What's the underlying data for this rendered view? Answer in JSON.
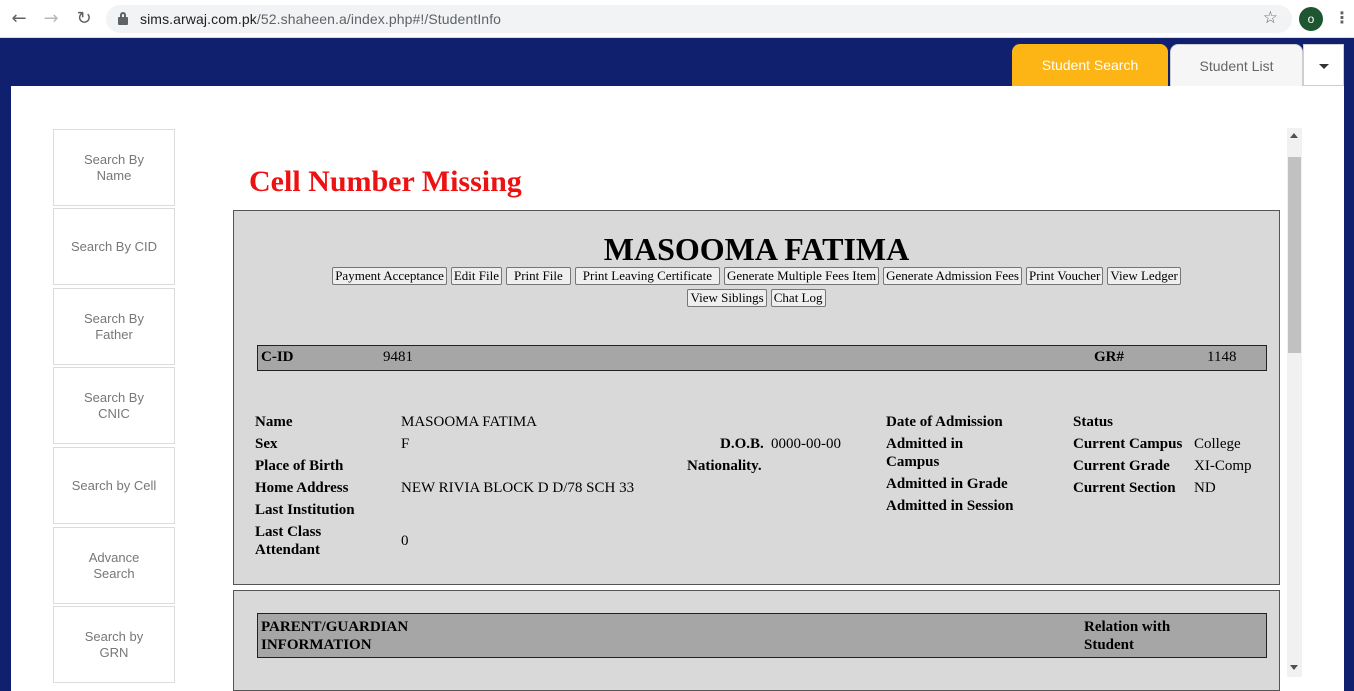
{
  "browser": {
    "url_host": "sims.arwaj.com.pk",
    "url_path": "/52.shaheen.a/index.php#!/StudentInfo",
    "profile_initial": "o"
  },
  "tabs": {
    "search": "Student Search",
    "list": "Student List"
  },
  "menu": [
    "Search By Name",
    "Search By CID",
    "Search By Father",
    "Search By CNIC",
    "Search by Cell",
    "Advance Search",
    "Search by GRN"
  ],
  "alert": "Cell Number Missing",
  "student": {
    "name": "MASOOMA FATIMA",
    "actions": [
      "Payment Acceptance",
      "Edit File",
      "Print File",
      "Print Leaving Certificate",
      "Generate Multiple Fees Item",
      "Generate Admission Fees",
      "Print Voucher",
      "View Ledger",
      "View Siblings",
      "Chat Log"
    ],
    "cid_label": "C-ID",
    "cid": "9481",
    "gr_label": "GR#",
    "gr": "1148",
    "fields": {
      "name_label": "Name",
      "name": "MASOOMA FATIMA",
      "sex_label": "Sex",
      "sex": "F",
      "dob_label": "D.O.B.",
      "dob": "0000-00-00",
      "pob_label": "Place of Birth",
      "nationality_label": "Nationality.",
      "address_label": "Home Address",
      "address": "NEW RIVIA BLOCK D D/78 SCH 33",
      "last_inst_label": "Last Institution",
      "last_class_label": "Last Class Attendant",
      "last_class": "0",
      "doa_label": "Date of Admission",
      "adm_campus_label": "Admitted in Campus",
      "adm_grade_label": "Admitted in Grade",
      "adm_session_label": "Admitted in Session",
      "status_label": "Status",
      "campus_label": "Current Campus",
      "campus": "College",
      "grade_label": "Current Grade",
      "grade": "XI-Comp",
      "section_label": "Current Section",
      "section": "ND"
    }
  },
  "parent": {
    "header": "PARENT/GUARDIAN INFORMATION",
    "relation": "Relation with Student"
  },
  "colors": {
    "header_bg": "#10206e",
    "active_tab": "#fdb515",
    "alert": "#ee1111",
    "card_bg": "#d9d9d9",
    "bar_bg": "#a6a6a6"
  }
}
